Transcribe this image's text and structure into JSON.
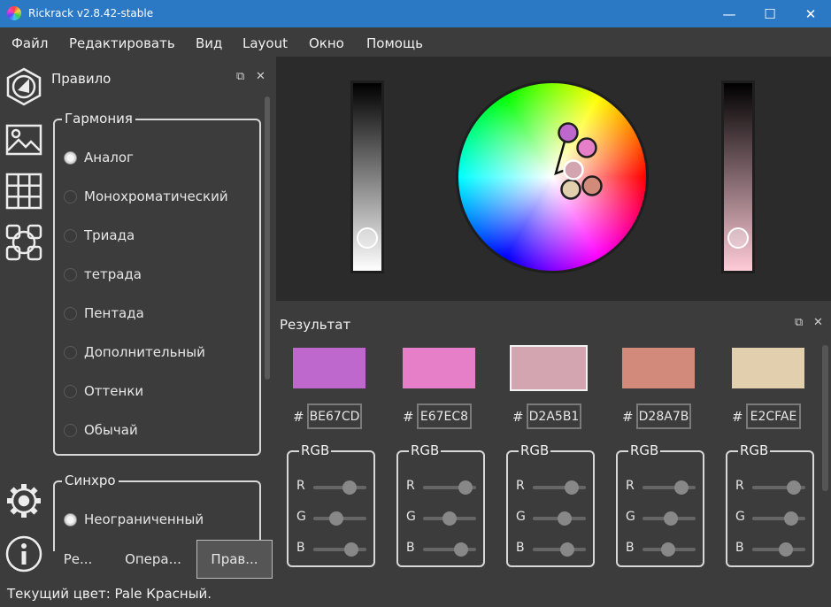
{
  "window": {
    "title": "Rickrack v2.8.42-stable",
    "minimize": "—",
    "maximize": "☐",
    "close": "✕"
  },
  "menu": [
    "Файл",
    "Редактировать",
    "Вид",
    "Layout",
    "Окно",
    "Помощь"
  ],
  "tools": [
    "wheel-icon",
    "image-icon",
    "grid-icon",
    "board-icon",
    "settings-icon",
    "info-icon"
  ],
  "rule_panel": {
    "title": "Правило",
    "float_icon": "⧉",
    "close_icon": "✕",
    "harmony": {
      "title": "Гармония",
      "options": [
        "Аналог",
        "Монохроматический",
        "Триада",
        "тетрада",
        "Пентада",
        "Дополнительный",
        "Оттенки",
        "Обычай"
      ],
      "selected": "Аналог"
    },
    "sync": {
      "title": "Синхро",
      "options": [
        "Неограниченный"
      ],
      "selected": "Неограниченный"
    },
    "tabs": [
      "Ре...",
      "Опера...",
      "Прав..."
    ],
    "active_tab": "Прав..."
  },
  "result_panel": {
    "title": "Результат",
    "float_icon": "⧉",
    "close_icon": "✕",
    "hash": "#",
    "group_label": "RGB",
    "channels": [
      "R",
      "G",
      "B"
    ],
    "colors": [
      {
        "hex": "BE67CD",
        "color": "#BE67CD",
        "r": 190,
        "g": 103,
        "b": 205
      },
      {
        "hex": "E67EC8",
        "color": "#E67EC8",
        "r": 230,
        "g": 126,
        "b": 200
      },
      {
        "hex": "D2A5B1",
        "color": "#D2A5B1",
        "r": 210,
        "g": 165,
        "b": 177,
        "selected": true
      },
      {
        "hex": "D28A7B",
        "color": "#D28A7B",
        "r": 210,
        "g": 138,
        "b": 123
      },
      {
        "hex": "E2CFAE",
        "color": "#E2CFAE",
        "r": 226,
        "g": 207,
        "b": 174
      }
    ]
  },
  "status": "Текущий цвет: Pale Красный."
}
